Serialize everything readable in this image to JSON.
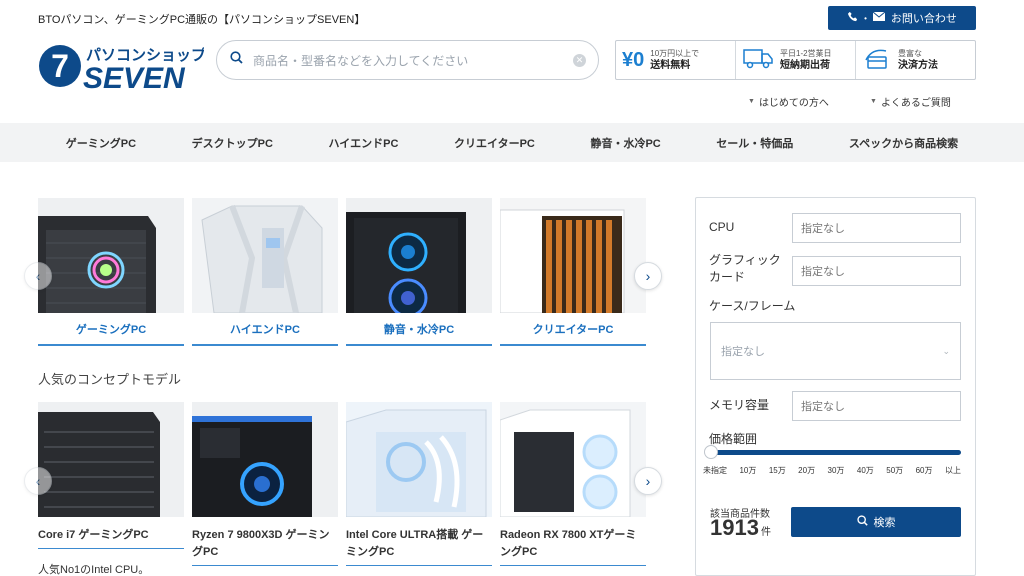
{
  "header": {
    "tagline": "BTOパソコン、ゲーミングPC通販の【パソコンショップSEVEN】",
    "contact_label": "お問い合わせ",
    "logo_top": "パソコンショップ",
    "logo_bottom": "SEVEN",
    "logo_number": "7",
    "search_placeholder": "商品名・型番名などを入力してください",
    "benefits": [
      {
        "icon": "yen-icon",
        "big": "¥0",
        "line1": "10万円以上で",
        "line2": "送料無料"
      },
      {
        "icon": "truck-icon",
        "big": "",
        "line1": "平日1-2営業日",
        "line2": "短納期出荷"
      },
      {
        "icon": "card-icon",
        "big": "",
        "line1": "豊富な",
        "line2": "決済方法"
      }
    ],
    "sublinks": [
      "はじめての方へ",
      "よくあるご質問"
    ]
  },
  "nav": [
    "ゲーミングPC",
    "デスクトップPC",
    "ハイエンドPC",
    "クリエイターPC",
    "静音・水冷PC",
    "セール・特価品",
    "スペックから商品検索"
  ],
  "categories": [
    "ゲーミングPC",
    "ハイエンドPC",
    "静音・水冷PC",
    "クリエイターPC"
  ],
  "section_title": "人気のコンセプトモデル",
  "models": [
    {
      "name": "Core i7 ゲーミングPC"
    },
    {
      "name": "Ryzen 7 9800X3D ゲーミングPC"
    },
    {
      "name": "Intel Core ULTRA搭載 ゲーミングPC"
    },
    {
      "name": "Radeon RX 7800 XTゲーミングPC"
    }
  ],
  "model_note": "人気No1のIntel CPU。",
  "filter": {
    "cpu_label": "CPU",
    "cpu_value": "指定なし",
    "gpu_label": "グラフィックカード",
    "gpu_value": "指定なし",
    "case_label": "ケース/フレーム",
    "case_value": "指定なし",
    "mem_label": "メモリ容量",
    "mem_value": "指定なし",
    "price_label": "価格範囲",
    "price_ticks": [
      "未指定",
      "10万",
      "15万",
      "20万",
      "30万",
      "40万",
      "50万",
      "60万",
      "以上"
    ],
    "count_label": "該当商品件数",
    "count": "1913",
    "count_unit": "件",
    "search_label": "検索"
  },
  "colors": {
    "brand": "#0d4a8a",
    "accent": "#1a6fbe",
    "nav_bg": "#f2f3f4"
  }
}
